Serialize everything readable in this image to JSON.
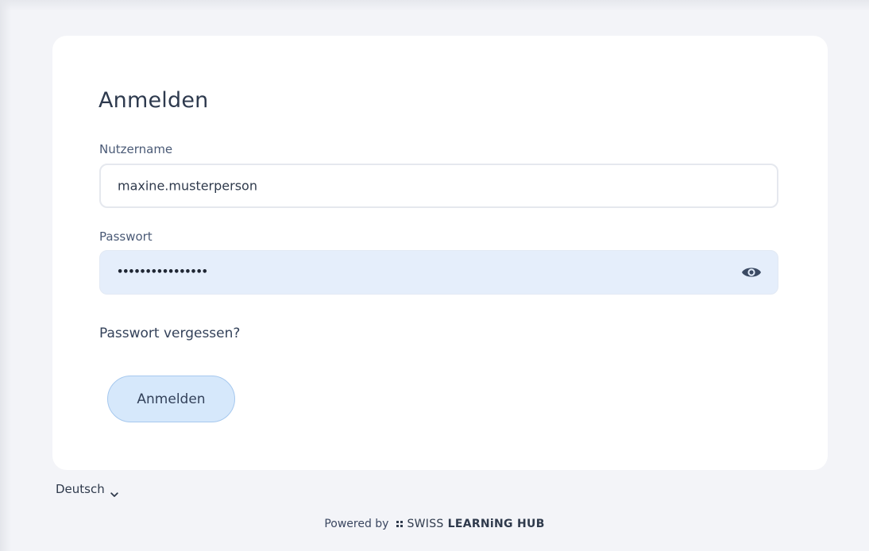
{
  "login": {
    "title": "Anmelden",
    "username_label": "Nutzername",
    "username_value": "maxine.musterperson",
    "password_label": "Passwort",
    "password_masked": "••••••••••••••••",
    "forgot_password": "Passwort vergessen?",
    "submit_label": "Anmelden"
  },
  "language": {
    "selected": "Deutsch"
  },
  "footer": {
    "powered_by": "Powered by",
    "brand_light": "SWISS",
    "brand_bold": "LEARNiNG HUB"
  },
  "icons": {
    "password_toggle": "eye-icon",
    "language_dropdown": "chevron-down-icon",
    "brand_logo": "brand-logo-icon"
  },
  "colors": {
    "background": "#f3f4f8",
    "card": "#ffffff",
    "password_field": "#e5eefb",
    "button": "#d6e8fb",
    "button_border": "#a6c8ee",
    "text": "#2f3a4c"
  }
}
